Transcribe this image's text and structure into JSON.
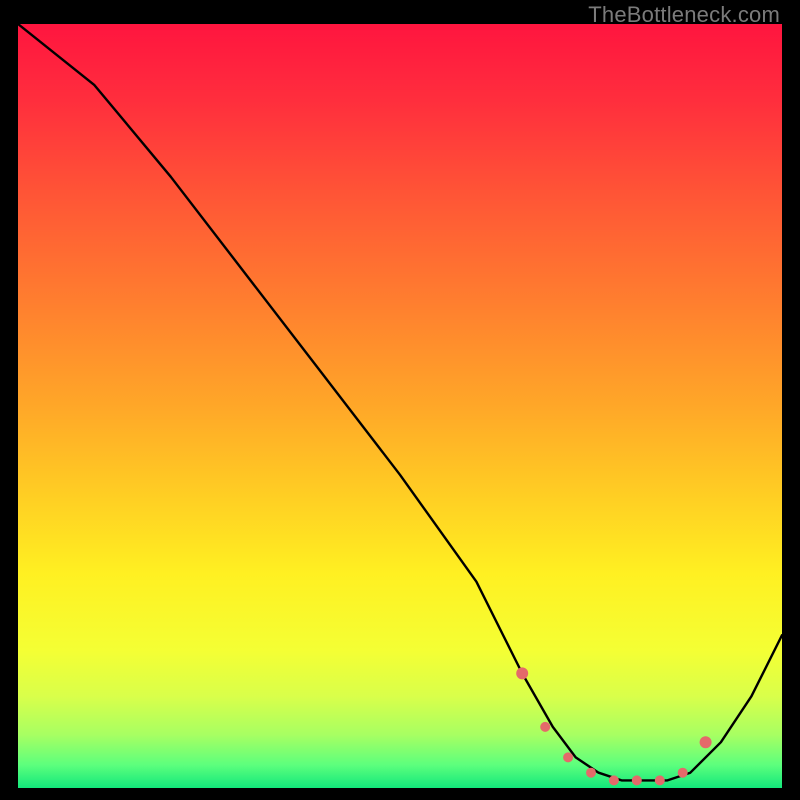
{
  "watermark": "TheBottleneck.com",
  "chart_data": {
    "type": "line",
    "title": "",
    "xlabel": "",
    "ylabel": "",
    "xlim": [
      0,
      100
    ],
    "ylim": [
      0,
      100
    ],
    "series": [
      {
        "name": "curve",
        "x": [
          0,
          10,
          20,
          30,
          40,
          50,
          60,
          66,
          70,
          73,
          76,
          79,
          82,
          85,
          88,
          92,
          96,
          100
        ],
        "y": [
          100,
          92,
          80,
          67,
          54,
          41,
          27,
          15,
          8,
          4,
          2,
          1,
          1,
          1,
          2,
          6,
          12,
          20
        ]
      }
    ],
    "highlight_band": {
      "from_x": 66,
      "to_x": 90,
      "y_at_points": [
        15,
        8,
        4,
        2,
        1,
        1,
        1,
        2,
        6
      ],
      "color": "#e46a6a"
    },
    "gradient_stops": [
      {
        "offset": 0.0,
        "color": "#ff153f"
      },
      {
        "offset": 0.1,
        "color": "#ff2e3d"
      },
      {
        "offset": 0.22,
        "color": "#ff5436"
      },
      {
        "offset": 0.36,
        "color": "#ff7d2f"
      },
      {
        "offset": 0.5,
        "color": "#ffa728"
      },
      {
        "offset": 0.62,
        "color": "#ffcf23"
      },
      {
        "offset": 0.72,
        "color": "#fff022"
      },
      {
        "offset": 0.82,
        "color": "#f4ff34"
      },
      {
        "offset": 0.88,
        "color": "#d9ff4a"
      },
      {
        "offset": 0.93,
        "color": "#a8ff62"
      },
      {
        "offset": 0.97,
        "color": "#5cff7d"
      },
      {
        "offset": 1.0,
        "color": "#12e87b"
      }
    ]
  }
}
